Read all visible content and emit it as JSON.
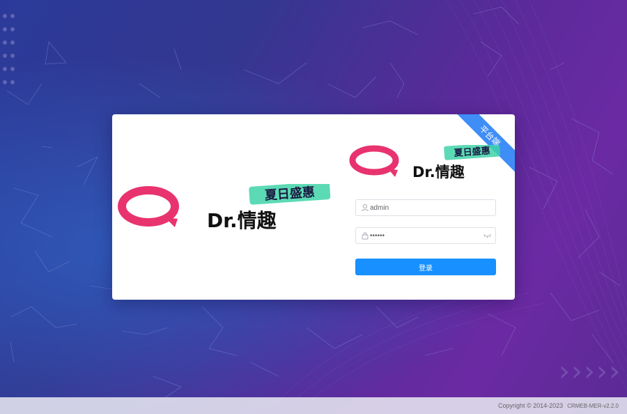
{
  "badge": {
    "text": "平台端"
  },
  "logo": {
    "brand_text": "Dr.情趣",
    "promo_text": "夏日盛惠"
  },
  "login": {
    "username_value": "admin",
    "password_value": "••••••",
    "submit_label": "登录"
  },
  "footer": {
    "copyright": "Copyright © 2014-2023",
    "version": "CRMEB-MER-v2.2.0"
  },
  "colors": {
    "primary": "#1890ff",
    "ribbon": "#3f8ef7",
    "logo_pink": "#e8336f",
    "promo_green": "#3fd3a8"
  },
  "icons": {
    "user": "user-icon",
    "lock": "lock-icon",
    "eye": "eye-closed-icon"
  }
}
